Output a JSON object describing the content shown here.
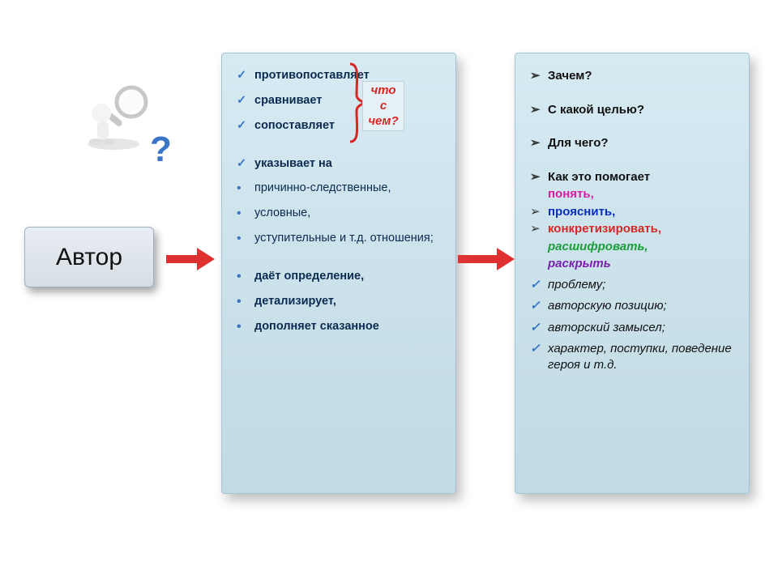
{
  "figure": {
    "question_mark": "?"
  },
  "author_box": {
    "label": "Автор"
  },
  "bracket_label": {
    "l1": "что",
    "l2": "с",
    "l3": "чем?"
  },
  "middle": {
    "i0": "противопоставляет",
    "i1": "сравнивает",
    "i2": "сопоставляет",
    "i3": "указывает на",
    "i4": "причинно-следственные,",
    "i5": "условные,",
    "i6": "уступительные и т.д. отношения;",
    "i7": "даёт определение,",
    "i8": "детализирует,",
    "i9": "дополняет сказанное"
  },
  "right": {
    "q0": "Зачем?",
    "q1": "С какой целью?",
    "q2": "Для чего?",
    "q3": "Как это помогает",
    "w_understand": "понять,",
    "w_clarify": "прояснить,",
    "w_concretize": "конкретизировать,",
    "w_decipher": "расшифровать,",
    "w_reveal": "раскрыть",
    "c0": "проблему;",
    "c1": "авторскую позицию;",
    "c2": "авторский замысел;",
    "c3": "характер, поступки, поведение героя и т.д."
  }
}
